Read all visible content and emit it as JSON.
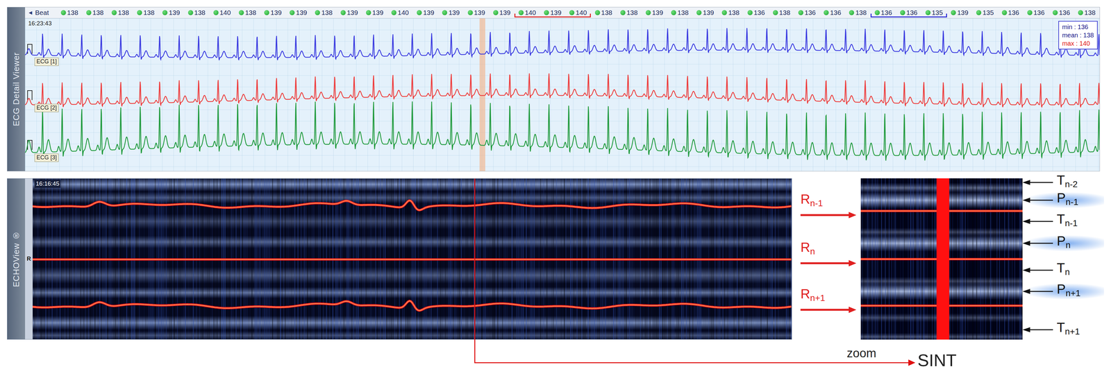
{
  "ecg_viewer": {
    "title": "ECG Detail Viewer",
    "time": "16:23:43",
    "beat_nav_icon": "◄",
    "beat_label": "Beat",
    "beats": [
      {
        "value": "138",
        "bracket": "none"
      },
      {
        "value": "138",
        "bracket": "none"
      },
      {
        "value": "138",
        "bracket": "none"
      },
      {
        "value": "138",
        "bracket": "none"
      },
      {
        "value": "139",
        "bracket": "none"
      },
      {
        "value": "138",
        "bracket": "none"
      },
      {
        "value": "140",
        "bracket": "none"
      },
      {
        "value": "138",
        "bracket": "none"
      },
      {
        "value": "139",
        "bracket": "none"
      },
      {
        "value": "139",
        "bracket": "none"
      },
      {
        "value": "138",
        "bracket": "none"
      },
      {
        "value": "139",
        "bracket": "none"
      },
      {
        "value": "139",
        "bracket": "none"
      },
      {
        "value": "140",
        "bracket": "none"
      },
      {
        "value": "139",
        "bracket": "none"
      },
      {
        "value": "139",
        "bracket": "none"
      },
      {
        "value": "139",
        "bracket": "none"
      },
      {
        "value": "139",
        "bracket": "none"
      },
      {
        "value": "140",
        "bracket": "red"
      },
      {
        "value": "139",
        "bracket": "red"
      },
      {
        "value": "140",
        "bracket": "red"
      },
      {
        "value": "138",
        "bracket": "none"
      },
      {
        "value": "138",
        "bracket": "none"
      },
      {
        "value": "139",
        "bracket": "none"
      },
      {
        "value": "138",
        "bracket": "none"
      },
      {
        "value": "139",
        "bracket": "none"
      },
      {
        "value": "138",
        "bracket": "none"
      },
      {
        "value": "136",
        "bracket": "none"
      },
      {
        "value": "138",
        "bracket": "none"
      },
      {
        "value": "136",
        "bracket": "none"
      },
      {
        "value": "136",
        "bracket": "none"
      },
      {
        "value": "138",
        "bracket": "none"
      },
      {
        "value": "136",
        "bracket": "blue"
      },
      {
        "value": "136",
        "bracket": "blue"
      },
      {
        "value": "135",
        "bracket": "blue"
      },
      {
        "value": "139",
        "bracket": "none"
      },
      {
        "value": "135",
        "bracket": "none"
      },
      {
        "value": "136",
        "bracket": "none"
      },
      {
        "value": "136",
        "bracket": "none"
      },
      {
        "value": "136",
        "bracket": "none"
      },
      {
        "value": "138",
        "bracket": "none"
      }
    ],
    "stats": [
      {
        "label": "min : 136",
        "color": "#1a1a8c"
      },
      {
        "label": "mean : 138",
        "color": "#1a1a8c"
      },
      {
        "label": "max : 140",
        "color": "#e01818"
      }
    ],
    "leads": [
      {
        "label": "ECG [1]",
        "color": "#3a3ae0"
      },
      {
        "label": "ECG [2]",
        "color": "#ee3b3b"
      },
      {
        "label": "ECG [3]",
        "color": "#1f9a3c"
      }
    ]
  },
  "echo_view": {
    "title": "ECHOView ®",
    "time": "16:16:45",
    "marker": "R"
  },
  "zoom_inset": {
    "left_labels": [
      {
        "base": "R",
        "sub": "n-1"
      },
      {
        "base": "R",
        "sub": "n"
      },
      {
        "base": "R",
        "sub": "n+1"
      }
    ],
    "right_labels": [
      {
        "base": "T",
        "sub": "n-2",
        "kind": "T"
      },
      {
        "base": "P",
        "sub": "n-1",
        "kind": "P"
      },
      {
        "base": "T",
        "sub": "n-1",
        "kind": "T"
      },
      {
        "base": "P",
        "sub": "n",
        "kind": "P"
      },
      {
        "base": "T",
        "sub": "n",
        "kind": "T"
      },
      {
        "base": "P",
        "sub": "n+1",
        "kind": "P"
      },
      {
        "base": "T",
        "sub": "n+1",
        "kind": "T"
      }
    ]
  },
  "annotation": {
    "zoom": "zoom",
    "target": "SINT"
  }
}
